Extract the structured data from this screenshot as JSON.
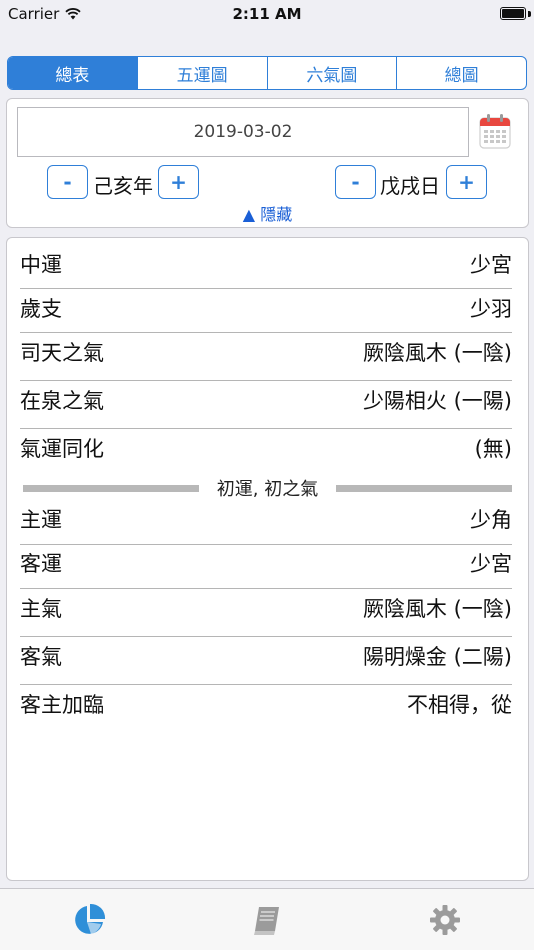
{
  "status_bar": {
    "carrier": "Carrier",
    "time": "2:11 AM"
  },
  "tabs": [
    {
      "label": "總表",
      "active": true
    },
    {
      "label": "五運圖",
      "active": false
    },
    {
      "label": "六氣圖",
      "active": false
    },
    {
      "label": "總圖",
      "active": false
    }
  ],
  "date_panel": {
    "date": "2019-03-02",
    "minus_label": "-",
    "plus_label": "+",
    "year_label": "己亥年",
    "day_label": "戊戌日",
    "hide_label": "▲ 隱藏"
  },
  "rows_top": [
    {
      "label": "中運",
      "value": "少宮"
    },
    {
      "label": "歲支",
      "value": "少羽"
    },
    {
      "label": "司天之氣",
      "value": "厥陰風木 (一陰)"
    },
    {
      "label": "在泉之氣",
      "value": "少陽相火 (一陽)"
    },
    {
      "label": "氣運同化",
      "value": "(無)"
    }
  ],
  "section_title": "初運, 初之氣",
  "rows_bottom": [
    {
      "label": "主運",
      "value": "少角"
    },
    {
      "label": "客運",
      "value": "少宮"
    },
    {
      "label": "主氣",
      "value": "厥陰風木 (一陰)"
    },
    {
      "label": "客氣",
      "value": "陽明燥金 (二陽)"
    },
    {
      "label": "客主加臨",
      "value": "不相得，從"
    }
  ],
  "tab_bar": [
    {
      "icon": "pie-chart-icon",
      "active": true
    },
    {
      "icon": "book-icon",
      "active": false
    },
    {
      "icon": "gear-icon",
      "active": false
    }
  ],
  "colors": {
    "accent": "#2f7fd8",
    "link": "#1a5fd6",
    "inactive_icon": "#9b9b9b"
  }
}
